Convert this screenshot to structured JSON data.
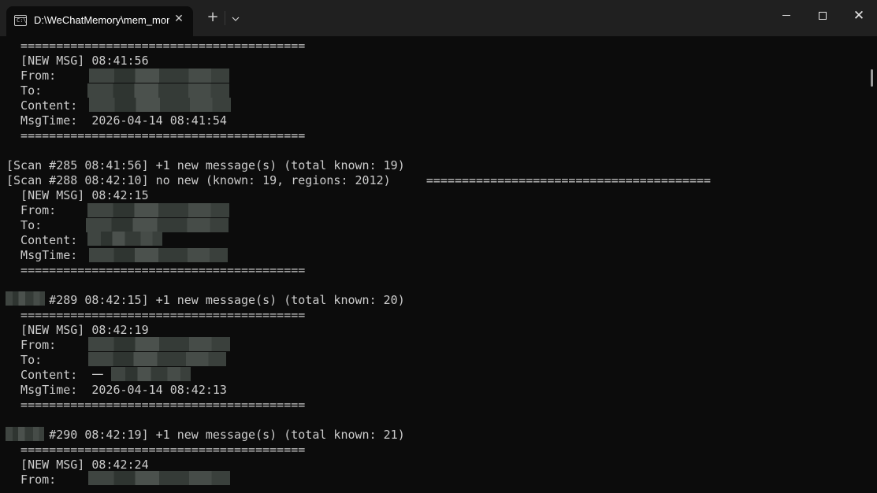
{
  "window": {
    "tab_title": "D:\\WeChatMemory\\mem_mon",
    "tab_icon": "terminal-icon",
    "tab_icon_glyph": "C:\\",
    "close_tab_glyph": "✕",
    "new_tab_glyph": "+",
    "dropdown_glyph": "⌄",
    "close_window_glyph": "✕"
  },
  "terminal": {
    "lines": [
      "  ========================================",
      "  [NEW MSG] 08:41:56",
      "  From:",
      "  To:",
      "  Content:",
      "  MsgTime:  2026-04-14 08:41:54",
      "  ========================================",
      "[Scan #285 08:41:56] +1 new message(s) (total known: 19)",
      "[Scan #288 08:42:10] no new (known: 19, regions: 2012)     ========================================",
      "  [NEW MSG] 08:42:15",
      "  From:",
      "  To:",
      "  Content:",
      "  MsgTime:",
      "  ========================================",
      "      #289 08:42:15] +1 new message(s) (total known: 20)",
      "  ========================================",
      "  [NEW MSG] 08:42:19",
      "  From:",
      "  To:",
      "  Content:  一",
      "  MsgTime:  2026-04-14 08:42:13",
      "  ========================================",
      "      #290 08:42:19] +1 new message(s) (total known: 21)",
      "  ========================================",
      "  [NEW MSG] 08:42:24",
      "  From:"
    ]
  }
}
